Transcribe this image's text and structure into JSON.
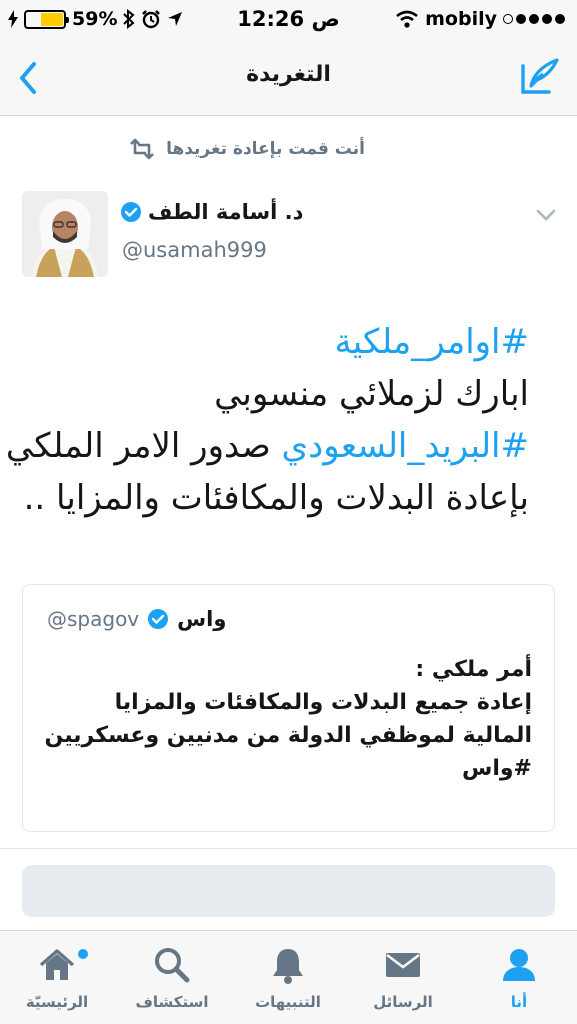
{
  "status_bar": {
    "battery": "59%",
    "battery_level": 0.59,
    "time": "12:26",
    "ampm": "ص",
    "carrier": "mobily"
  },
  "nav": {
    "title": "التغريدة",
    "back_icon": "chevron-left-icon",
    "compose_icon": "compose-tweet-icon"
  },
  "retweet_context": {
    "text": "أنت قمت بإعادة تغريدها",
    "icon": "retweet-icon"
  },
  "tweet": {
    "author_name": "د. أسامة الطف",
    "handle": "@usamah999",
    "lines": [
      {
        "text": "#اوامر_ملكية",
        "hashtag": true
      },
      {
        "text": "ابارك لزملائي منسوبي",
        "hashtag": false
      }
    ],
    "line3_hashtag": "#البريد_السعودي",
    "line3_rest": " صدور الامر الملكي",
    "line4": "بإعادة البدلات والمكافئات والمزايا .."
  },
  "quoted_tweet": {
    "name": "واس",
    "handle": "@spagov",
    "lines": [
      "أمر ملكي :",
      "إعادة جميع البدلات والمكافئات والمزايا",
      "المالية لموظفي الدولة من مدنيين وعسكريين",
      "#واس"
    ]
  },
  "tabs": {
    "home": "الرئيسيّة",
    "explore": "استكشاف",
    "notifications": "التنبيهات",
    "messages": "الرسائل",
    "me": "أنا"
  },
  "colors": {
    "accent": "#1da1f2",
    "secondary": "#657786",
    "battery": "#ffcc00"
  }
}
